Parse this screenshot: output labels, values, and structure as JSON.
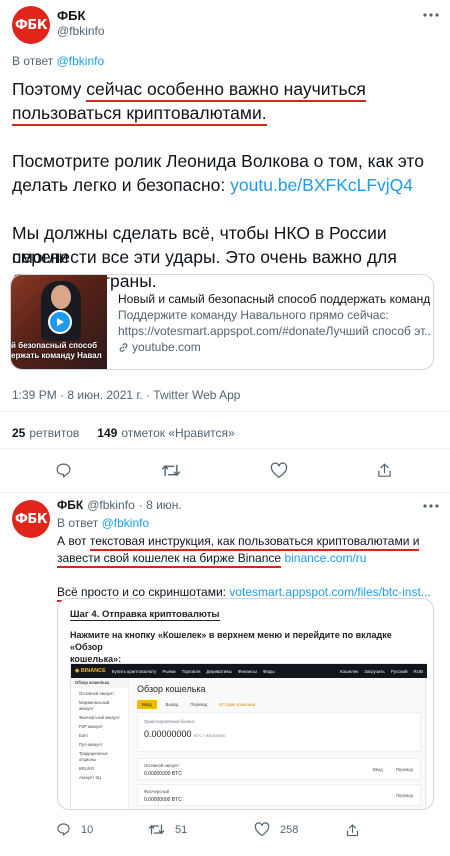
{
  "tweet1": {
    "avatar_text": "ФБК",
    "name": "ФБК",
    "handle": "@fbkinfo",
    "reply_prefix": "В ответ",
    "reply_handle": "@fbkinfo",
    "para1_line1_pre": "Поэтому ",
    "para1_line1_hl": "сейчас особенно важно научиться",
    "para1_line2_hl": "пользоваться криптовалютами.",
    "para2_line1": "Посмотрите ролик Леонида Волкова о том, как это",
    "para2_line2_pre": "делать легко и безопасно: ",
    "para2_link": "youtu.be/BXFKcLFvjQ4",
    "para3_line1": "Мы должны сделать всё, чтобы НКО в России смогли",
    "para3_line2": "перенести все эти удары. Это очень важно для",
    "para3_line3": "будущего страны.",
    "card": {
      "thumb_text_line1": "й безопасный способ",
      "thumb_text_line2": "ержать команду Навал",
      "title": "Новый и самый безопасный способ поддержать команду...",
      "desc_line1": "Поддержите команду Навального прямо сейчас:",
      "desc_line2": "https://votesmart.appspot.com/#donateЛучший способ эт...",
      "domain": "youtube.com"
    },
    "timestamp": "1:39 PM · 8 июн. 2021 г. · Twitter Web App",
    "retweets_count": "25",
    "retweets_label": "ретвитов",
    "likes_count": "149",
    "likes_label": "отметок «Нравится»"
  },
  "tweet2": {
    "avatar_text": "ФБК",
    "name": "ФБК",
    "handle": "@fbkinfo",
    "time": "· 8 июн.",
    "reply_prefix": "В ответ",
    "reply_handle": "@fbkinfo",
    "line1_pre": "А вот ",
    "line1_hl": "текстовая инструкция, как пользоваться криптовалютами и",
    "line2_hl": "завести свой кошелек на бирже Binance",
    "line2_link": "binance.com/ru",
    "line3_hl": "Всё просто и со скриншотами:",
    "line3_link": "votesmart.appspot.com/files/btc-inst...",
    "image": {
      "step_title": "Шаг 4. Отправка криптовалюты",
      "instruction_line1": "Нажмите на кнопку «Кошелек» в верхнем меню и перейдите по вкладке «Обзор",
      "instruction_line2": "кошелька»:",
      "brand": "BINANCE",
      "nav_items": [
        "Купить криптовалюту",
        "Рынки",
        "Торговля",
        "Деривативы",
        "Финансы",
        "Фиды"
      ],
      "nav_right": [
        "Кошелек",
        "Загрузить",
        "Русский",
        "RUB"
      ],
      "sidebar_active": "Обзор кошелька",
      "sidebar_items": [
        "Основной аккаунт",
        "Маржинальный аккаунт",
        "Фьючерсный аккаунт",
        "P2P аккаунт",
        "Earn",
        "Пул-аккаунт",
        "Традиционные опционы",
        "BRL/KR",
        "Аккаунт ЗЦ"
      ],
      "wallet_title": "Обзор кошелька",
      "btn_deposit": "Ввод",
      "btn_withdraw": "Вывод",
      "btn_transfer": "Перевод",
      "btn_history": "История кошелька",
      "estimated_label": "Ориентировочный баланс",
      "balance_value": "0.00000000",
      "balance_unit": "BTC ≈ $0.000000",
      "row1_label": "Основной аккаунт",
      "row1_value": "0.00000000 BTC",
      "row1_btn1": "Ввод",
      "row1_btn2": "Перевод",
      "row2_label": "Фьючерсный",
      "row2_value": "0.00000000 BTC",
      "row2_btn1": "Перевод"
    },
    "reply_count": "10",
    "retweet_count": "51",
    "like_count": "258"
  },
  "colors": {
    "accent": "#1d9bf0",
    "brand_red": "#e0251b",
    "underline_red": "#d7251d",
    "binance_yellow": "#f0b90b"
  }
}
